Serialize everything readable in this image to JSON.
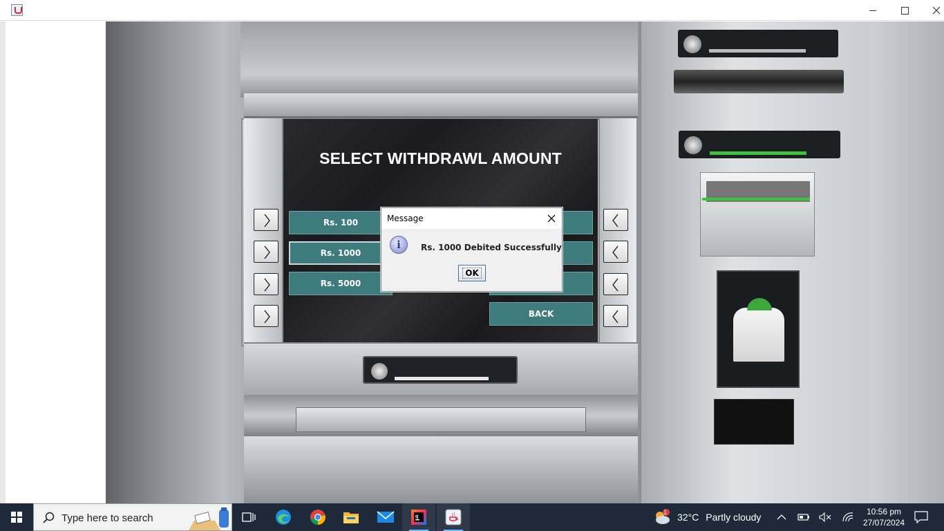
{
  "window": {
    "app_icon": "java-app-icon",
    "controls": [
      "minimize",
      "maximize",
      "close"
    ]
  },
  "screen": {
    "title": "SELECT WITHDRAWL AMOUNT",
    "amount_buttons": [
      {
        "label": "Rs. 100"
      },
      {
        "label": "Rs. 1000"
      },
      {
        "label": "Rs. 5000"
      }
    ],
    "back_label": "BACK"
  },
  "dialog": {
    "title": "Message",
    "message": "Rs. 1000 Debited Successfully",
    "ok_label": "OK",
    "icon": "info-icon"
  },
  "taskbar": {
    "search_placeholder": "Type here to search",
    "apps": [
      "task-view",
      "edge",
      "chrome",
      "file-explorer",
      "mail",
      "intellij",
      "java"
    ],
    "weather": {
      "temp": "32°C",
      "condition": "Partly cloudy",
      "badge": "1"
    },
    "time": "10:56 pm",
    "date": "27/07/2024"
  },
  "colors": {
    "button_teal": "#3e7b7c",
    "taskbar": "#1e2a3a"
  }
}
